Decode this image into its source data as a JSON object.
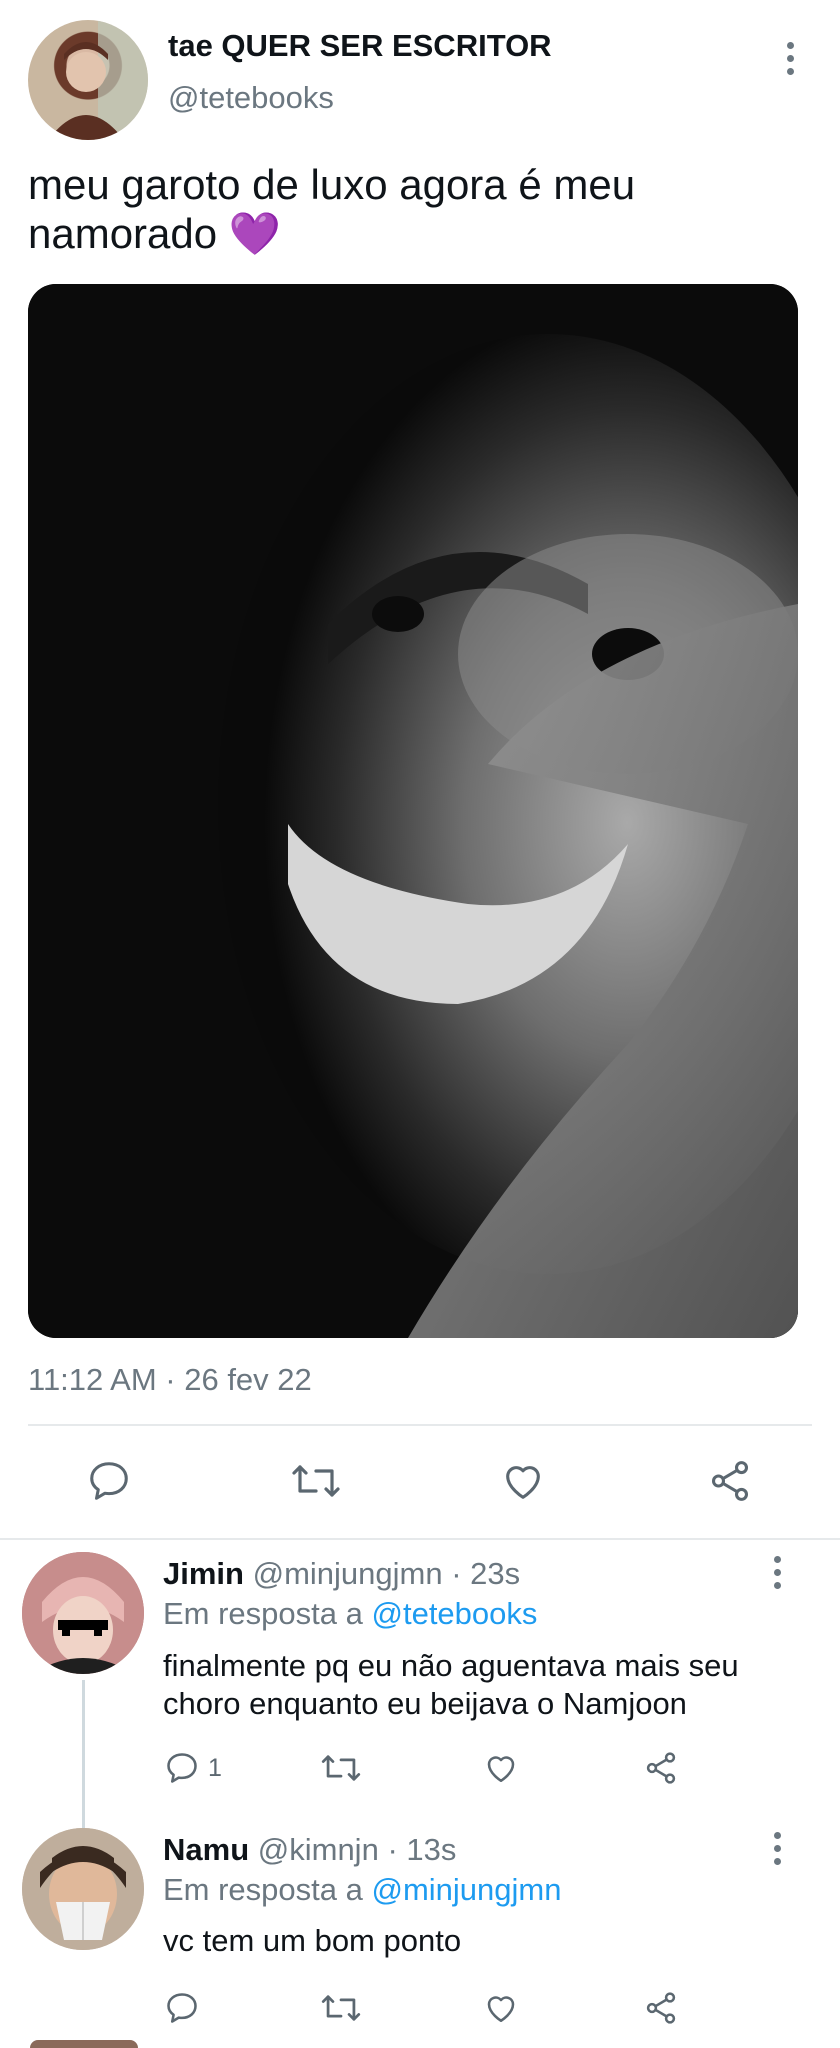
{
  "tweet": {
    "author_name": "tae QUER SER ESCRITOR",
    "author_handle": "@tetebooks",
    "text": "meu garoto de luxo agora é meu namorado",
    "emoji": "💜",
    "timestamp": "11:12 AM · 26 fev 22"
  },
  "replies": [
    {
      "name": "Jimin",
      "handle": "@minjungjmn",
      "time": "· 23s",
      "reply_prefix": "Em resposta a",
      "reply_to": "@tetebooks",
      "text": "finalmente pq eu não aguentava mais seu choro enquanto eu beijava o Namjoon",
      "reply_count": "1"
    },
    {
      "name": "Namu",
      "handle": "@kimnjn",
      "time": "· 13s",
      "reply_prefix": "Em resposta a",
      "reply_to": "@minjungjmn",
      "text": "vc tem um bom ponto",
      "reply_count": ""
    }
  ],
  "icons": {
    "reply": "reply-icon",
    "retweet": "retweet-icon",
    "like": "heart-icon",
    "share": "share-icon",
    "more": "more-vertical-icon"
  },
  "colors": {
    "link": "#1d9bf0",
    "secondary_text": "#6b7780",
    "divider": "#e6e9eb"
  }
}
